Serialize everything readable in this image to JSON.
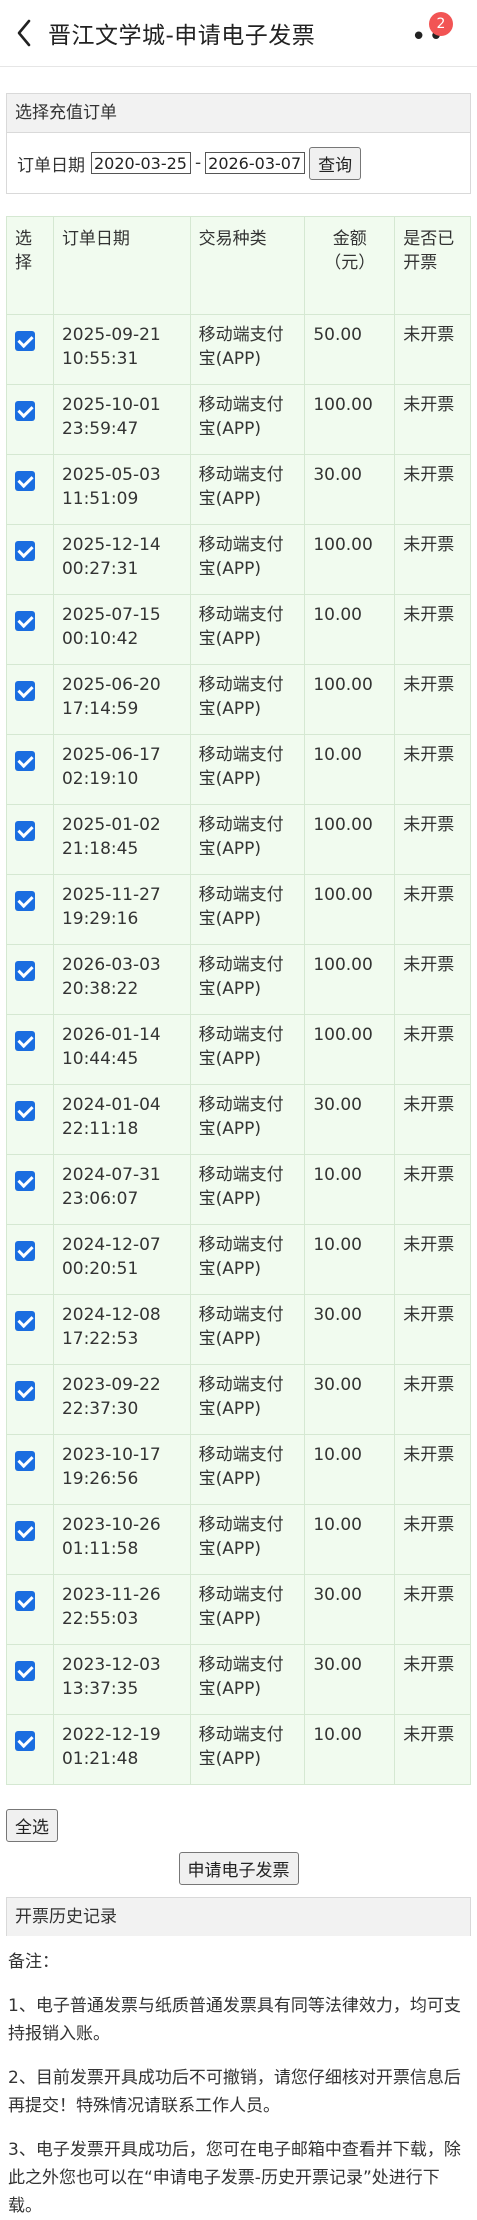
{
  "header": {
    "title": "晋江文学城-申请电子发票",
    "badge": "2"
  },
  "filter": {
    "section_title": "选择充值订单",
    "date_label": "订单日期",
    "start_date": "2020-03-25",
    "end_date": "2026-03-07",
    "separator": "-",
    "query_label": "查询"
  },
  "table": {
    "headers": {
      "select": "选择",
      "date": "订单日期",
      "type": "交易种类",
      "amount": "金额（元）",
      "status": "是否已开票"
    },
    "rows": [
      {
        "date": "2025-09-21",
        "time": "10:55:31",
        "type": "移动端支付宝(APP)",
        "amount": "50.00",
        "status": "未开票"
      },
      {
        "date": "2025-10-01",
        "time": "23:59:47",
        "type": "移动端支付宝(APP)",
        "amount": "100.00",
        "status": "未开票"
      },
      {
        "date": "2025-05-03",
        "time": "11:51:09",
        "type": "移动端支付宝(APP)",
        "amount": "30.00",
        "status": "未开票"
      },
      {
        "date": "2025-12-14",
        "time": "00:27:31",
        "type": "移动端支付宝(APP)",
        "amount": "100.00",
        "status": "未开票"
      },
      {
        "date": "2025-07-15",
        "time": "00:10:42",
        "type": "移动端支付宝(APP)",
        "amount": "10.00",
        "status": "未开票"
      },
      {
        "date": "2025-06-20",
        "time": "17:14:59",
        "type": "移动端支付宝(APP)",
        "amount": "100.00",
        "status": "未开票"
      },
      {
        "date": "2025-06-17",
        "time": "02:19:10",
        "type": "移动端支付宝(APP)",
        "amount": "10.00",
        "status": "未开票"
      },
      {
        "date": "2025-01-02",
        "time": "21:18:45",
        "type": "移动端支付宝(APP)",
        "amount": "100.00",
        "status": "未开票"
      },
      {
        "date": "2025-11-27",
        "time": "19:29:16",
        "type": "移动端支付宝(APP)",
        "amount": "100.00",
        "status": "未开票"
      },
      {
        "date": "2026-03-03",
        "time": "20:38:22",
        "type": "移动端支付宝(APP)",
        "amount": "100.00",
        "status": "未开票"
      },
      {
        "date": "2026-01-14",
        "time": "10:44:45",
        "type": "移动端支付宝(APP)",
        "amount": "100.00",
        "status": "未开票"
      },
      {
        "date": "2024-01-04",
        "time": "22:11:18",
        "type": "移动端支付宝(APP)",
        "amount": "30.00",
        "status": "未开票"
      },
      {
        "date": "2024-07-31",
        "time": "23:06:07",
        "type": "移动端支付宝(APP)",
        "amount": "10.00",
        "status": "未开票"
      },
      {
        "date": "2024-12-07",
        "time": "00:20:51",
        "type": "移动端支付宝(APP)",
        "amount": "10.00",
        "status": "未开票"
      },
      {
        "date": "2024-12-08",
        "time": "17:22:53",
        "type": "移动端支付宝(APP)",
        "amount": "30.00",
        "status": "未开票"
      },
      {
        "date": "2023-09-22",
        "time": "22:37:30",
        "type": "移动端支付宝(APP)",
        "amount": "30.00",
        "status": "未开票"
      },
      {
        "date": "2023-10-17",
        "time": "19:26:56",
        "type": "移动端支付宝(APP)",
        "amount": "10.00",
        "status": "未开票"
      },
      {
        "date": "2023-10-26",
        "time": "01:11:58",
        "type": "移动端支付宝(APP)",
        "amount": "10.00",
        "status": "未开票"
      },
      {
        "date": "2023-11-26",
        "time": "22:55:03",
        "type": "移动端支付宝(APP)",
        "amount": "30.00",
        "status": "未开票"
      },
      {
        "date": "2023-12-03",
        "time": "13:37:35",
        "type": "移动端支付宝(APP)",
        "amount": "30.00",
        "status": "未开票"
      },
      {
        "date": "2022-12-19",
        "time": "01:21:48",
        "type": "移动端支付宝(APP)",
        "amount": "10.00",
        "status": "未开票"
      }
    ]
  },
  "actions": {
    "select_all": "全选",
    "apply": "申请电子发票"
  },
  "history": {
    "title": "开票历史记录"
  },
  "notes": {
    "heading": "备注：",
    "items": [
      "1、电子普通发票与纸质普通发票具有同等法律效力，均可支持报销入账。",
      "2、目前发票开具成功后不可撤销，请您仔细核对开票信息后再提交！特殊情况请联系工作人员。",
      "3、电子发票开具成功后，您可在电子邮箱中查看并下载，除此之外您也可以在“申请电子发票-历史开票记录”处进行下载。"
    ]
  },
  "colors": {
    "accent": "#1a6de0",
    "badge": "#f25454",
    "table_bg": "#f1fbef"
  },
  "icons": {
    "back": "chevron-left-icon",
    "more": "more-dots-icon"
  }
}
